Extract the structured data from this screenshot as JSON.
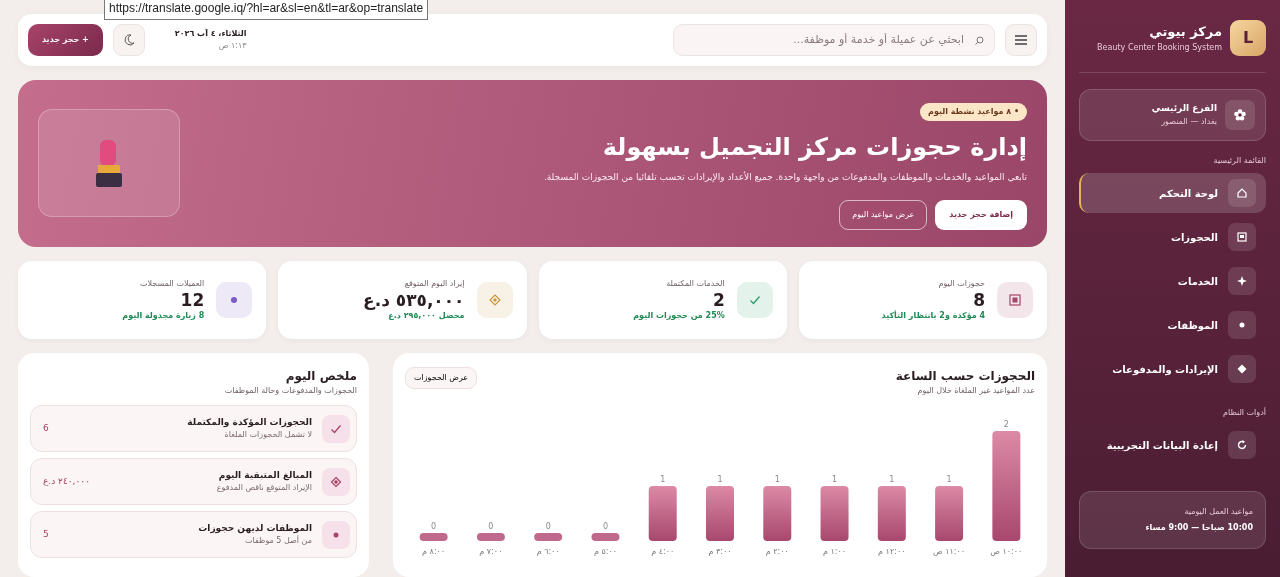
{
  "link_tooltip": "https://translate.google.iq/?hl=ar&sl=en&tl=ar&op=translate",
  "sidebar": {
    "logo_letter": "L",
    "title": "مركز بيوتي",
    "subtitle": "Beauty Center Booking System",
    "branch": {
      "name": "الفرع الرئيسي",
      "location": "بغداد — المنصور"
    },
    "sections": [
      {
        "heading": "القائمة الرئيسية",
        "items": [
          {
            "label": "لوحة التحكم",
            "selected": true
          },
          {
            "label": "الحجوزات",
            "selected": false
          },
          {
            "label": "الخدمات",
            "selected": false
          },
          {
            "label": "الموظفات",
            "selected": false
          },
          {
            "label": "الإيرادات والمدفوعات",
            "selected": false
          }
        ]
      },
      {
        "heading": "أدوات النظام",
        "items": [
          {
            "label": "إعادة البيانات التجريبية",
            "selected": false
          }
        ]
      }
    ],
    "hours": {
      "label": "مواعيد العمل اليومية",
      "value": "10:00 صباحا — 9:00 مساء"
    }
  },
  "topbar": {
    "search": {
      "placeholder": "ابحثي عن عميلة أو خدمة أو موظفة..."
    },
    "date": "الثلاثاء، ٤ آب ٢٠٢٦",
    "time": "١:١٣ ص",
    "new_button": "+ حجز جديد"
  },
  "hero": {
    "badge": "• ٨ مواعيد نشطة اليوم",
    "title": "إدارة حجوزات مركز التجميل بسهولة",
    "text": "تابعي المواعيد والخدمات والموظفات والمدفوعات من واجهة واحدة. جميع الأعداد والإيرادات تحسب تلقائيا من الحجوزات المسجلة.",
    "buttons": [
      "إضافة حجز جديد",
      "عرض مواعيد اليوم"
    ]
  },
  "stats": [
    {
      "label": "حجوزات اليوم",
      "value": "8",
      "note": "4 مؤكدة و2 بانتظار التأكيد",
      "color": "#a8436a"
    },
    {
      "label": "الخدمات المكتملة",
      "value": "2",
      "note": "25% من حجوزات اليوم",
      "color": "#2e9c6a"
    },
    {
      "label": "إيراد اليوم المتوقع",
      "value": "٥٣٥,٠٠٠ د.ع",
      "note": "محصل ٢٩٥,٠٠٠ د.ع",
      "color": "#c9953a"
    },
    {
      "label": "العميلات المسجلات",
      "value": "12",
      "note": "8 زيارة مجدولة اليوم",
      "color": "#7b5cc4"
    }
  ],
  "chart_panel": {
    "title": "الحجوزات حسب الساعة",
    "subtitle": "عدد المواعيد غير الملغاة خلال اليوم",
    "button": "عرض الحجوزات",
    "chart_data": {
      "type": "bar",
      "categories": [
        "٨:٠٠ م",
        "٧:٠٠ م",
        "٦:٠٠ م",
        "٥:٠٠ م",
        "٤:٠٠ م",
        "٣:٠٠ م",
        "٢:٠٠ م",
        "١:٠٠ م",
        "١٢:٠٠ م",
        "١١:٠٠ ص",
        "١٠:٠٠ ص"
      ],
      "values": [
        0,
        0,
        0,
        0,
        1,
        1,
        1,
        1,
        1,
        1,
        2
      ],
      "data_labels": true
    }
  },
  "summary": {
    "title": "ملخص اليوم",
    "subtitle": "الحجوزات والمدفوعات وحالة الموظفات",
    "items": [
      {
        "title": "الحجوزات المؤكدة والمكتملة",
        "note": "لا تشمل الحجوزات الملغاة",
        "value": "6"
      },
      {
        "title": "المبالغ المتبقية اليوم",
        "note": "الإيراد المتوقع ناقص المدفوع",
        "value": "٢٤٠,٠٠٠ د.ع"
      },
      {
        "title": "الموظفات لديهن حجوزات",
        "note": "من أصل 5 موظفات",
        "value": "5"
      }
    ]
  }
}
